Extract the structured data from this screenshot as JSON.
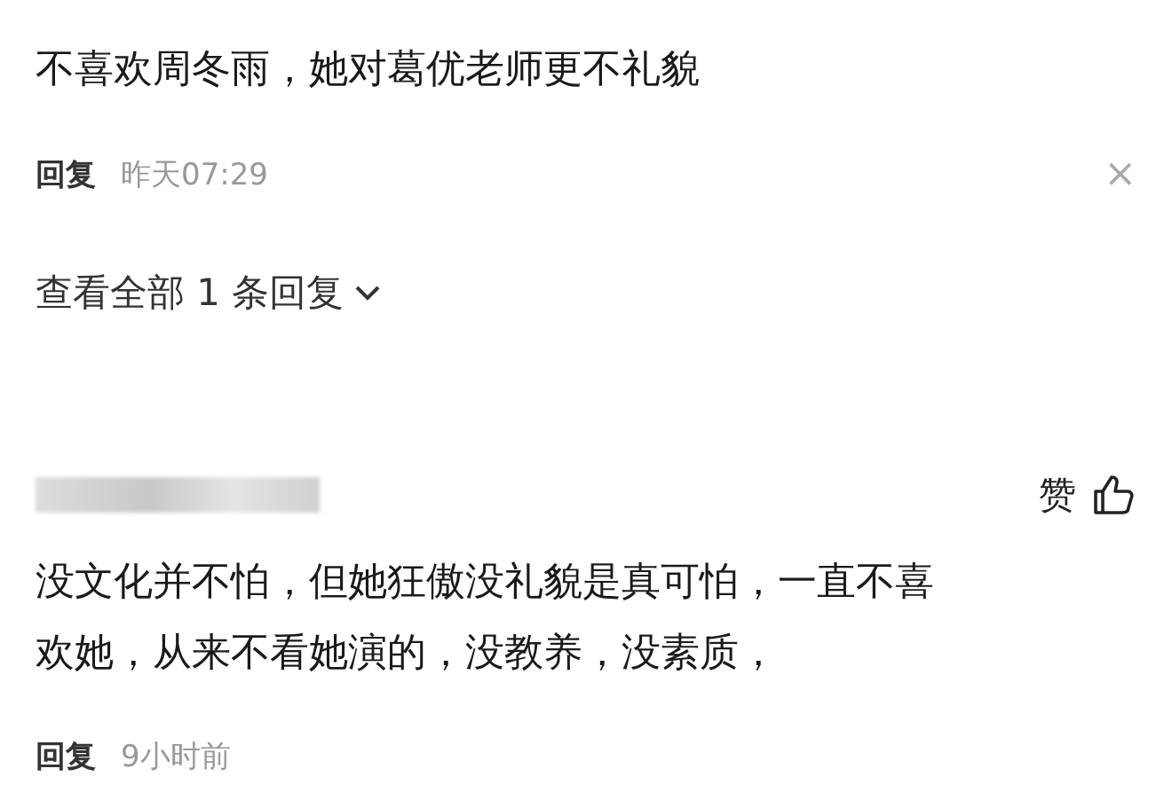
{
  "comments": [
    {
      "text": "不喜欢周冬雨，她对葛优老师更不礼貌",
      "reply_label": "回复",
      "time": "昨天07:29",
      "close": "×",
      "more_replies": "查看全部 1 条回复"
    },
    {
      "text": "没文化并不怕，但她狂傲没礼貌是真可怕，一直不喜欢她，从来不看她演的，没教养，没素质，",
      "reply_label": "回复",
      "time": "9小时前",
      "like_label": "赞",
      "author_hidden": true
    }
  ]
}
